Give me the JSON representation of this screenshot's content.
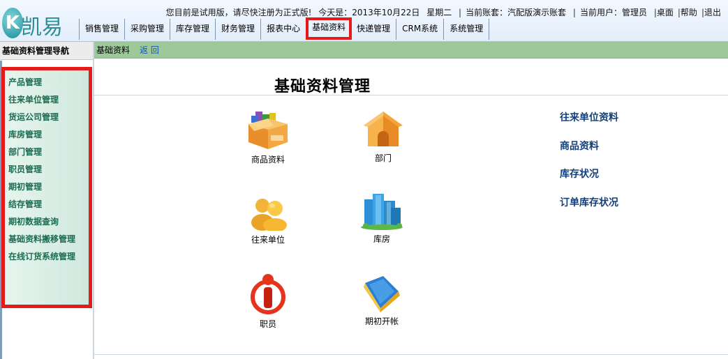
{
  "logo": {
    "k": "K",
    "text": "凯易通"
  },
  "topline": {
    "notice": "您目前是试用版，请尽快注册为正式版!",
    "date": "今天是：2013年10月22日",
    "weekday": "星期二",
    "account": "当前账套：汽配版演示账套",
    "user": "当前用户：管理员",
    "desktop": "桌面",
    "help": "帮助",
    "exit": "退出",
    "separator": "|"
  },
  "nav": {
    "items": [
      {
        "label": "销售管理"
      },
      {
        "label": "采购管理"
      },
      {
        "label": "库存管理"
      },
      {
        "label": "财务管理"
      },
      {
        "label": "报表中心"
      },
      {
        "label": "基础资料"
      },
      {
        "label": "快递管理"
      },
      {
        "label": "CRM系统"
      },
      {
        "label": "系统管理"
      }
    ],
    "active_color": "#e51a1a"
  },
  "sidebar": {
    "title": "基础资料管理导航",
    "items": [
      {
        "label": "产品管理"
      },
      {
        "label": "往来单位管理"
      },
      {
        "label": "货运公司管理"
      },
      {
        "label": "库房管理"
      },
      {
        "label": "部门管理"
      },
      {
        "label": "职员管理"
      },
      {
        "label": "期初管理"
      },
      {
        "label": "结存管理"
      },
      {
        "label": "期初数据查询"
      },
      {
        "label": "基础资料搬移管理"
      },
      {
        "label": "在线订货系统管理"
      }
    ]
  },
  "breadcrumb": {
    "current": "基础资料",
    "back": "返 回"
  },
  "main": {
    "title": "基础资料管理",
    "tiles": [
      {
        "label": "商品资料",
        "icon": "boxes-icon"
      },
      {
        "label": "部门",
        "icon": "house-icon"
      },
      {
        "label": "往来单位",
        "icon": "people-icon"
      },
      {
        "label": "库房",
        "icon": "buildings-icon"
      },
      {
        "label": "职员",
        "icon": "info-person-icon"
      },
      {
        "label": "期初开帐",
        "icon": "book-icon"
      }
    ],
    "links": [
      {
        "label": "往来单位资料"
      },
      {
        "label": "商品资料"
      },
      {
        "label": "库存状况"
      },
      {
        "label": "订单库存状况"
      }
    ]
  },
  "colors": {
    "accent_green": "#9cc89a",
    "link_blue": "#12407c",
    "menu_green": "#1b6c50",
    "highlight_red": "#e51a1a"
  }
}
